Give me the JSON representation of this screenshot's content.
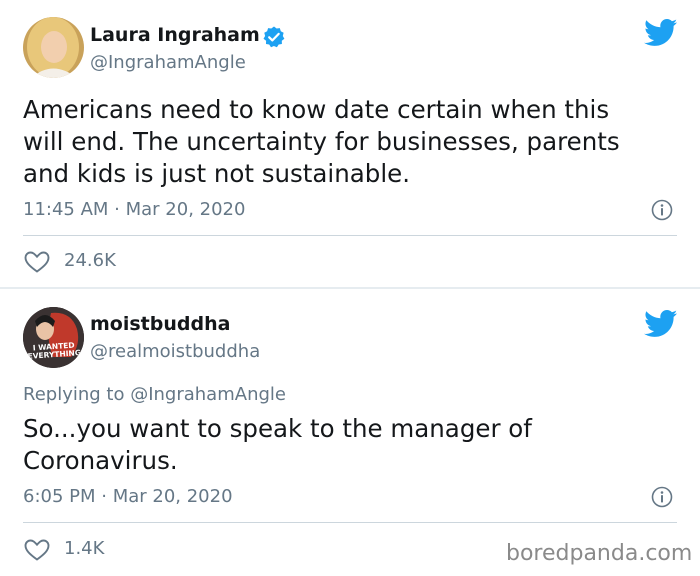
{
  "tweets": [
    {
      "display_name": "Laura Ingraham",
      "handle": "@IngrahamAngle",
      "verified": true,
      "text": "Americans need to know date certain when this\nwill end.  The uncertainty for businesses, parents\nand kids is just not sustainable.",
      "timestamp": "11:45 AM · Mar 20, 2020",
      "likes": "24.6K"
    },
    {
      "display_name": "moistbuddha",
      "handle": "@realmoistbuddha",
      "reply_prefix": "Replying to ",
      "reply_handle": "@IngrahamAngle",
      "avatar_text": "I WANTED EVERYTHING",
      "text": "So...you want to speak to the manager of\nCoronavirus.",
      "timestamp": "6:05 PM · Mar 20, 2020",
      "likes": "1.4K"
    }
  ],
  "watermark": "boredpanda.com",
  "colors": {
    "twitter_blue": "#1da1f2",
    "text": "#14171a",
    "secondary": "#657786",
    "divider": "#ccd6dd"
  },
  "icons": [
    "verified-badge-icon",
    "twitter-bird-icon",
    "info-icon",
    "heart-icon"
  ]
}
